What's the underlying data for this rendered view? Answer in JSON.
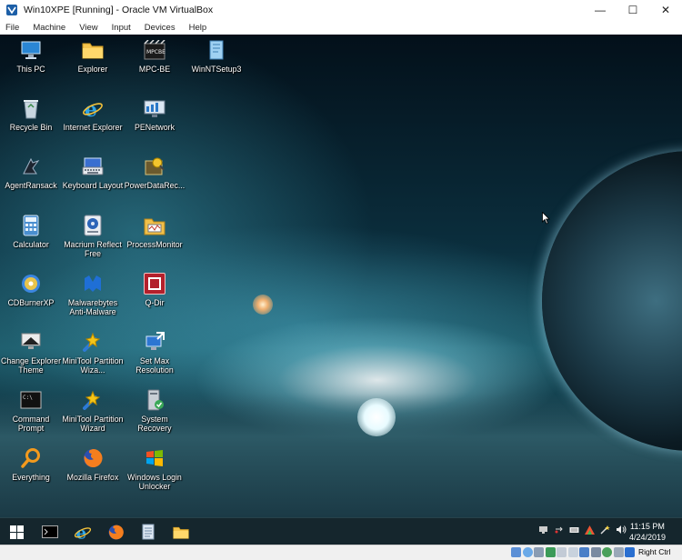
{
  "window": {
    "title": "Win10XPE [Running] - Oracle VM VirtualBox",
    "controls": {
      "minimize": "—",
      "maximize": "☐",
      "close": "✕"
    }
  },
  "menubar": [
    "File",
    "Machine",
    "View",
    "Input",
    "Devices",
    "Help"
  ],
  "desktop": {
    "icons": [
      {
        "label": "This PC",
        "icon": "computer-icon"
      },
      {
        "label": "Explorer",
        "icon": "folder-icon"
      },
      {
        "label": "MPC-BE",
        "icon": "mpc-be-icon"
      },
      {
        "label": "WinNTSetup3",
        "icon": "winntsetup-icon"
      },
      {
        "label": "Recycle Bin",
        "icon": "recycle-bin-icon"
      },
      {
        "label": "Internet Explorer",
        "icon": "internet-explorer-icon"
      },
      {
        "label": "PENetwork",
        "icon": "network-icon"
      },
      {
        "label": "AgentRansack",
        "icon": "agent-ransack-icon"
      },
      {
        "label": "Keyboard Layout",
        "icon": "keyboard-icon"
      },
      {
        "label": "PowerDataRec...",
        "icon": "power-data-recovery-icon"
      },
      {
        "label": "Calculator",
        "icon": "calculator-icon"
      },
      {
        "label": "Macrium Reflect Free",
        "icon": "macrium-reflect-icon"
      },
      {
        "label": "ProcessMonitor",
        "icon": "process-monitor-icon"
      },
      {
        "label": "CDBurnerXP",
        "icon": "cd-burner-icon"
      },
      {
        "label": "Malwarebytes Anti-Malware",
        "icon": "malwarebytes-icon"
      },
      {
        "label": "Q-Dir",
        "icon": "q-dir-icon"
      },
      {
        "label": "Change Explorer Theme",
        "icon": "theme-icon"
      },
      {
        "label": "MiniTool Partition Wiza...",
        "icon": "minitool-icon"
      },
      {
        "label": "Set Max Resolution",
        "icon": "resolution-icon"
      },
      {
        "label": "Command Prompt",
        "icon": "command-prompt-icon"
      },
      {
        "label": "MiniTool Partition Wizard",
        "icon": "minitool-icon"
      },
      {
        "label": "System Recovery",
        "icon": "system-recovery-icon"
      },
      {
        "label": "Everything",
        "icon": "everything-search-icon"
      },
      {
        "label": "Mozilla Firefox",
        "icon": "firefox-icon"
      },
      {
        "label": "Windows Login Unlocker",
        "icon": "windows-unlocker-icon"
      }
    ]
  },
  "taskbar": {
    "pinned": [
      "start-icon",
      "console-icon",
      "internet-explorer-icon",
      "firefox-icon",
      "notepad-icon",
      "folder-icon"
    ],
    "clock": {
      "time": "11:15 PM",
      "date": "4/24/2019"
    }
  },
  "statusbar": {
    "host_key": "Right Ctrl"
  }
}
